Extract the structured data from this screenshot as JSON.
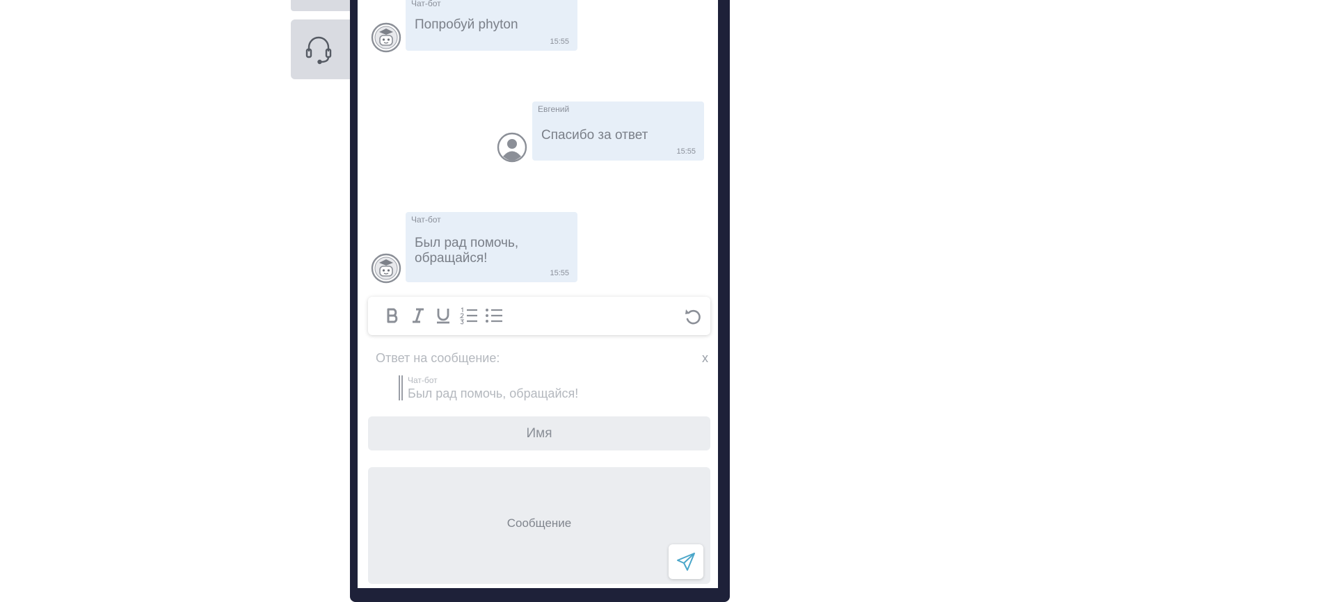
{
  "messages": [
    {
      "author": "Чат-бот",
      "text": "Попробуй phyton",
      "time": "15:55",
      "side": "left",
      "avatar": "robot-avatar-icon"
    },
    {
      "author": "Евгений",
      "text": "Спасибо за ответ",
      "time": "15:55",
      "side": "right",
      "avatar": "user-avatar-icon"
    },
    {
      "author": "Чат-бот",
      "text_line1": "Был рад помочь,",
      "text_line2": "обращайся!",
      "time": "15:55",
      "side": "left",
      "avatar": "robot-avatar-icon"
    }
  ],
  "toolbar": {
    "icons": [
      "bold-icon",
      "italic-icon",
      "underline-icon",
      "ordered-list-icon",
      "bullet-list-icon",
      "undo-icon"
    ]
  },
  "reply": {
    "label": "Ответ на сообщение:",
    "close": "x",
    "quoted_author": "Чат-бот",
    "quoted_text": "Был рад помочь, обращайся!"
  },
  "form": {
    "name_placeholder": "Имя",
    "message_placeholder": "Сообщение",
    "send_icon": "send-icon"
  },
  "side_tab": {
    "icon": "headset-icon"
  },
  "colors": {
    "frame": "#1e2139",
    "bubble": "#e7eff8",
    "side_tab": "#d9dbe1",
    "send_accent": "#4aa6c9"
  }
}
